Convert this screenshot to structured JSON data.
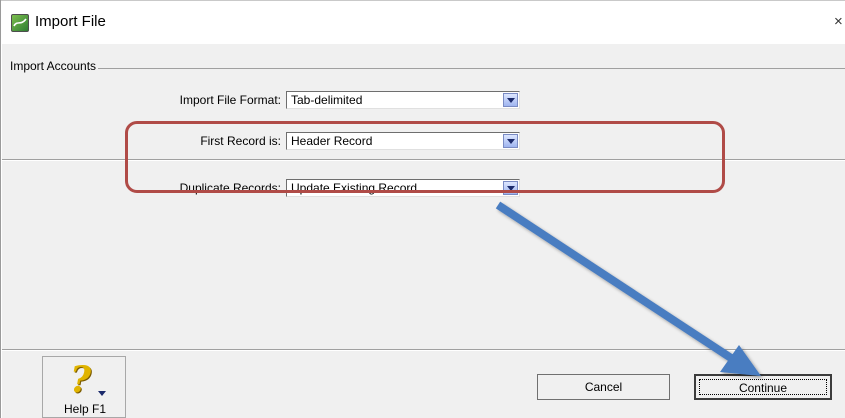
{
  "window": {
    "title": "Import File",
    "close_glyph": "×"
  },
  "group": {
    "label": "Import Accounts"
  },
  "fields": [
    {
      "label": "Import File Format:",
      "value": "Tab-delimited"
    },
    {
      "label": "First Record is:",
      "value": "Header Record"
    },
    {
      "label": "Duplicate Records:",
      "value": "Update Existing Record"
    }
  ],
  "buttons": {
    "help_label": "Help F1",
    "help_glyph": "?",
    "cancel_label": "Cancel",
    "continue_label": "Continue"
  },
  "annotation": {
    "highlight_color": "#b04b47",
    "arrow_color": "#4a7dc1"
  },
  "icons": {
    "app": "import-file-app-icon",
    "help": "question-mark-icon",
    "dropdown": "chevron-down-icon",
    "close": "close-icon"
  }
}
